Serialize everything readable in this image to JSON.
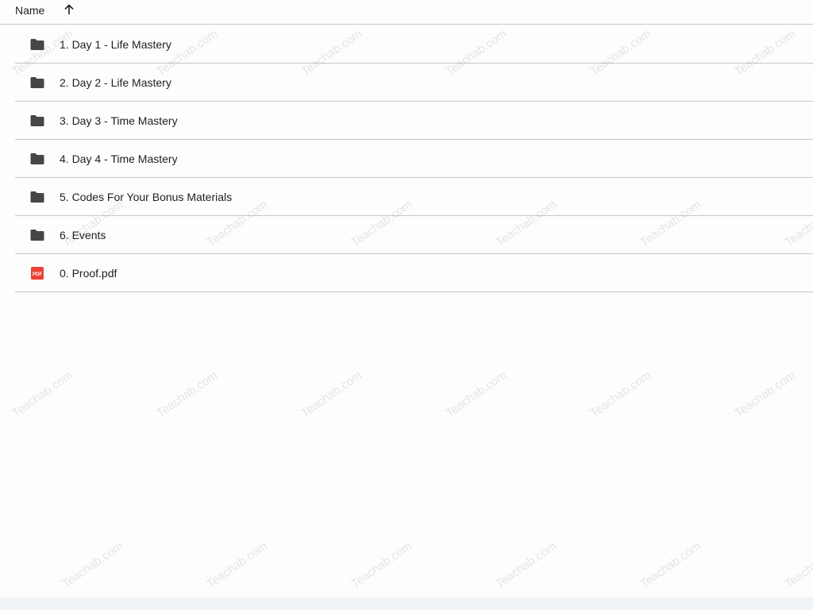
{
  "header": {
    "name_label": "Name",
    "sort_icon": "arrow-up-icon"
  },
  "files": [
    {
      "label": "1. Day 1 - Life Mastery",
      "icon": "folder-icon",
      "kind": "folder"
    },
    {
      "label": "2. Day 2 - Life Mastery",
      "icon": "folder-icon",
      "kind": "folder"
    },
    {
      "label": "3. Day 3 - Time Mastery",
      "icon": "folder-icon",
      "kind": "folder"
    },
    {
      "label": "4. Day 4 - Time Mastery",
      "icon": "folder-icon",
      "kind": "folder"
    },
    {
      "label": "5. Codes For Your Bonus Materials",
      "icon": "folder-icon",
      "kind": "folder"
    },
    {
      "label": "6. Events",
      "icon": "folder-icon",
      "kind": "folder"
    },
    {
      "label": "0. Proof.pdf",
      "icon": "pdf-icon",
      "kind": "pdf"
    }
  ],
  "pdf_badge_text": "PDF",
  "watermark_text": "Teachab.com",
  "colors": {
    "folder": "#444746",
    "pdf": "#ea4335",
    "divider": "#c7c7c7",
    "text": "#1f1f1f"
  }
}
